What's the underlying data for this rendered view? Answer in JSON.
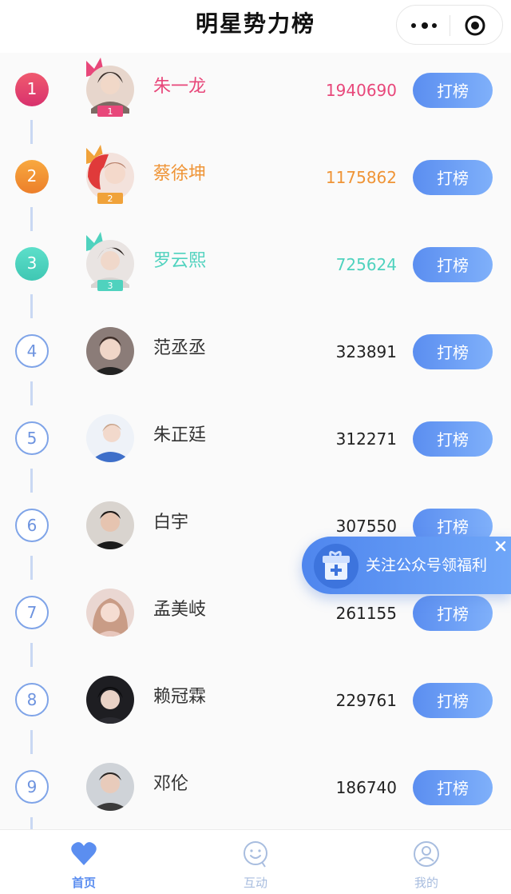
{
  "header": {
    "title": "明星势力榜"
  },
  "colors": {
    "rank1": "#e8477a",
    "rank2": "#f0952d",
    "rank3": "#4fd2be",
    "accent": "#5b8ef0",
    "tab_active": "#5b8ef0",
    "tab_inactive": "#a8bddf"
  },
  "list": {
    "items": [
      {
        "rank": "1",
        "name": "朱一龙",
        "score": "1940690",
        "button": "打榜",
        "badge": "1"
      },
      {
        "rank": "2",
        "name": "蔡徐坤",
        "score": "1175862",
        "button": "打榜",
        "badge": "2"
      },
      {
        "rank": "3",
        "name": "罗云熙",
        "score": "725624",
        "button": "打榜",
        "badge": "3"
      },
      {
        "rank": "4",
        "name": "范丞丞",
        "score": "323891",
        "button": "打榜"
      },
      {
        "rank": "5",
        "name": "朱正廷",
        "score": "312271",
        "button": "打榜"
      },
      {
        "rank": "6",
        "name": "白宇",
        "score": "307550",
        "button": "打榜"
      },
      {
        "rank": "7",
        "name": "孟美岐",
        "score": "261155",
        "button": "打榜"
      },
      {
        "rank": "8",
        "name": "赖冠霖",
        "score": "229761",
        "button": "打榜"
      },
      {
        "rank": "9",
        "name": "邓伦",
        "score": "186740",
        "button": "打榜"
      }
    ]
  },
  "promo": {
    "text": "关注公众号领福利",
    "icon": "gift-icon"
  },
  "tabbar": {
    "tabs": [
      {
        "label": "首页",
        "icon": "heart-icon",
        "active": true
      },
      {
        "label": "互动",
        "icon": "smile-icon",
        "active": false
      },
      {
        "label": "我的",
        "icon": "user-icon",
        "active": false
      }
    ]
  }
}
